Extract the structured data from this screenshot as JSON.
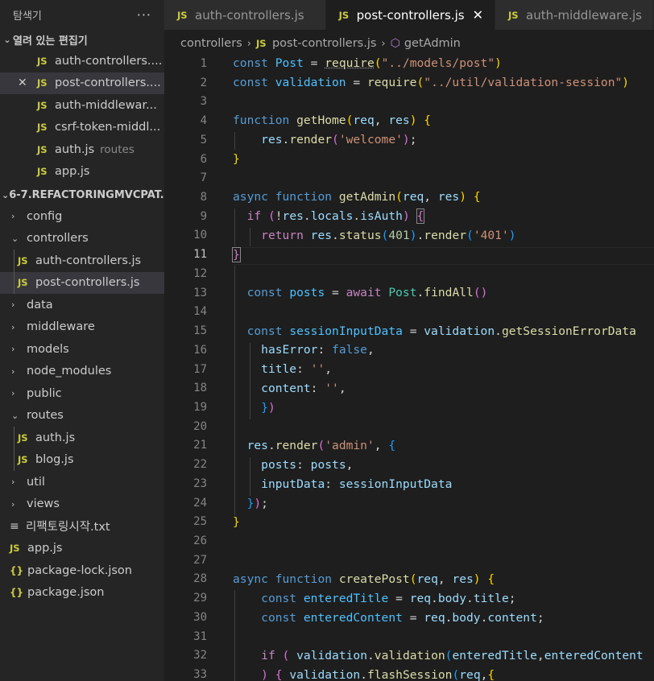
{
  "sidebar": {
    "title": "탐색기",
    "more_label": "···",
    "open_editors": {
      "title": "열려 있는 편집기",
      "items": [
        {
          "label": "auth-controllers....",
          "icon": "JS"
        },
        {
          "label": "post-controllers....",
          "icon": "JS"
        },
        {
          "label": "auth-middlewar...",
          "icon": "JS"
        },
        {
          "label": "csrf-token-middl...",
          "icon": "JS"
        },
        {
          "label": "auth.js",
          "icon": "JS",
          "hint": "routes"
        },
        {
          "label": "app.js",
          "icon": "JS"
        }
      ]
    },
    "project": {
      "title": "6-7.REFACTORINGMVCPAT...",
      "tree": [
        {
          "label": "config",
          "type": "folder",
          "open": false
        },
        {
          "label": "controllers",
          "type": "folder",
          "open": true
        },
        {
          "label": "auth-controllers.js",
          "type": "file"
        },
        {
          "label": "post-controllers.js",
          "type": "file"
        },
        {
          "label": "data",
          "type": "folder",
          "open": false
        },
        {
          "label": "middleware",
          "type": "folder",
          "open": false
        },
        {
          "label": "models",
          "type": "folder",
          "open": false
        },
        {
          "label": "node_modules",
          "type": "folder",
          "open": false
        },
        {
          "label": "public",
          "type": "folder",
          "open": false
        },
        {
          "label": "routes",
          "type": "folder",
          "open": true
        },
        {
          "label": "auth.js",
          "type": "file"
        },
        {
          "label": "blog.js",
          "type": "file"
        },
        {
          "label": "util",
          "type": "folder",
          "open": false
        },
        {
          "label": "views",
          "type": "folder",
          "open": false
        },
        {
          "label": "리팩토링시작.txt",
          "type": "text"
        },
        {
          "label": "app.js",
          "type": "file"
        },
        {
          "label": "package-lock.json",
          "type": "json"
        },
        {
          "label": "package.json",
          "type": "json"
        }
      ]
    }
  },
  "tabs": [
    {
      "label": "auth-controllers.js",
      "icon": "JS",
      "active": false
    },
    {
      "label": "post-controllers.js",
      "icon": "JS",
      "active": true
    },
    {
      "label": "auth-middleware.js",
      "icon": "JS",
      "active": false
    }
  ],
  "breadcrumb": {
    "folder": "controllers",
    "file": "post-controllers.js",
    "symbol": "getAdmin"
  },
  "editor": {
    "current_line": 11,
    "line_numbers": [
      "1",
      "2",
      "3",
      "4",
      "5",
      "6",
      "7",
      "8",
      "9",
      "10",
      "11",
      "12",
      "13",
      "14",
      "15",
      "16",
      "17",
      "18",
      "19",
      "20",
      "21",
      "22",
      "23",
      "24",
      "25",
      "26",
      "27",
      "28",
      "29",
      "30",
      "31",
      "32",
      "33"
    ]
  },
  "colors": {
    "keyword": "#569cd6",
    "control": "#c586c0",
    "function": "#dcdcaa",
    "variable": "#9cdcfe",
    "string": "#ce9178",
    "number": "#b5cea8",
    "class": "#4ec9b0",
    "icon_js": "#cbcb41"
  }
}
